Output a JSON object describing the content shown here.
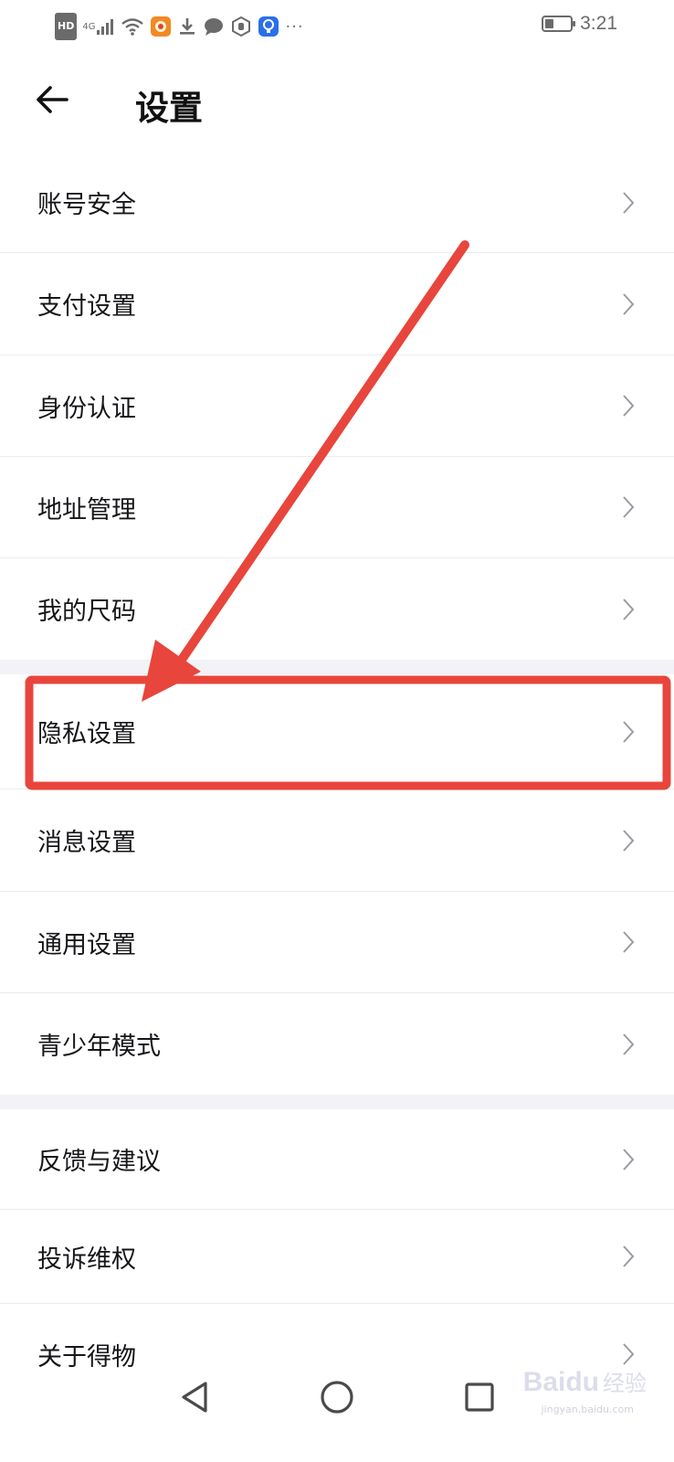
{
  "status_bar": {
    "hd_badge": "HD",
    "network": "4G",
    "time": "3:21",
    "battery_level": 0.35,
    "more_dots": "···"
  },
  "header": {
    "back_icon": "arrow-left-icon",
    "title": "设置"
  },
  "groups": [
    [
      {
        "label": "账号安全"
      },
      {
        "label": "支付设置"
      },
      {
        "label": "身份认证"
      },
      {
        "label": "地址管理"
      },
      {
        "label": "我的尺码"
      }
    ],
    [
      {
        "label": "隐私设置"
      },
      {
        "label": "消息设置"
      },
      {
        "label": "通用设置"
      },
      {
        "label": "青少年模式"
      }
    ],
    [
      {
        "label": "反馈与建议"
      },
      {
        "label": "投诉维权"
      },
      {
        "label": "关于得物"
      }
    ]
  ],
  "annotation": {
    "highlighted_item": "隐私设置",
    "color": "#e8453c"
  },
  "navbar": {
    "back": "triangle-back-icon",
    "home": "circle-home-icon",
    "recents": "square-recents-icon"
  },
  "watermark": {
    "brand": "Baidu",
    "suffix": "经验",
    "url": "jingyan.baidu.com"
  },
  "colors": {
    "text": "#16161a",
    "divider": "#ececf0",
    "section_gap": "#f3f3f7",
    "chevron": "#9a9aa3"
  }
}
